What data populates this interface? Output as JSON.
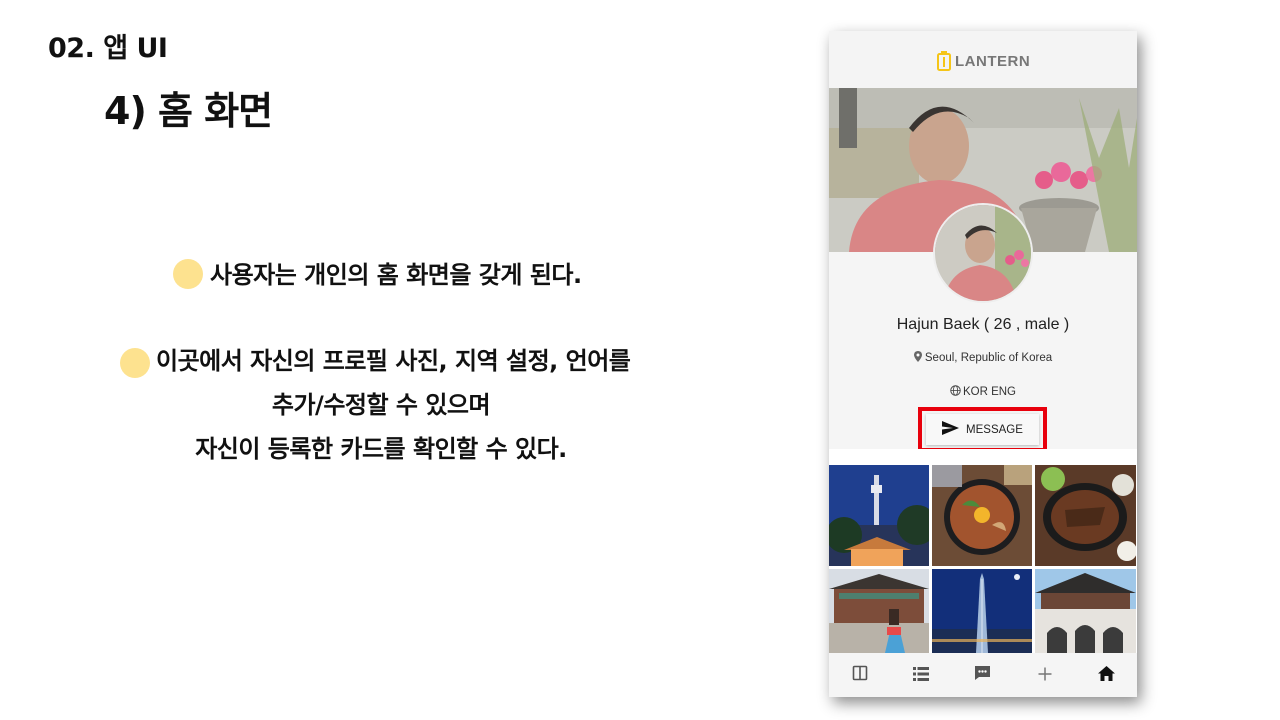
{
  "slide": {
    "section": "02. 앱 UI",
    "title": "4) 홈 화면"
  },
  "bullets": {
    "first": "사용자는 개인의 홈 화면을 갖게 된다.",
    "second_line1": "이곳에서 자신의 프로필 사진, 지역 설정, 언어를",
    "second_line2": "추가/수정할 수 있으며",
    "second_line3": "자신이 등록한 카드를 확인할 수 있다."
  },
  "app": {
    "logo_text": "LANTERN",
    "profile": {
      "name_line": "Hajun Baek ( 26 , male )",
      "location": "Seoul, Republic of Korea",
      "languages": "KOR ENG"
    },
    "message_button": "MESSAGE",
    "gallery": [
      "N Seoul Tower at night",
      "Bibimbap",
      "Bulgogi hot plate",
      "Palace with hanbok visitor",
      "Lotte World Tower at night",
      "Gwanghwamun gate"
    ],
    "tabs": [
      "book-icon",
      "list-icon",
      "chat-icon",
      "plus-icon",
      "home-icon"
    ]
  },
  "colors": {
    "bullet_dot": "#fde28f",
    "highlight": "#e8000c",
    "logo_accent": "#f5c518"
  }
}
